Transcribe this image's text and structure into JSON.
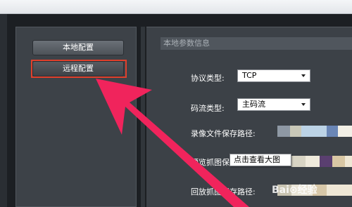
{
  "sidebar": {
    "items": [
      {
        "label": "本地配置"
      },
      {
        "label": "远程配置"
      }
    ]
  },
  "panel": {
    "section_title": "本地参数信息",
    "protocol": {
      "label": "协议类型:",
      "value": "TCP"
    },
    "stream": {
      "label": "码流类型:",
      "value": "主码流"
    },
    "record_path": {
      "label": "录像文件保存路径:"
    },
    "preview_path": {
      "label": "预览抓图保"
    },
    "playback_path": {
      "label": "回放抓图保存路径:"
    }
  },
  "tooltip": {
    "text": "点击查看大图"
  },
  "colors": {
    "highlight_border": "#e0402c",
    "arrow": "#f0245c",
    "panel_bg": "#3c4147"
  },
  "icons": {
    "arrow": "pointer-arrow-annotation"
  }
}
